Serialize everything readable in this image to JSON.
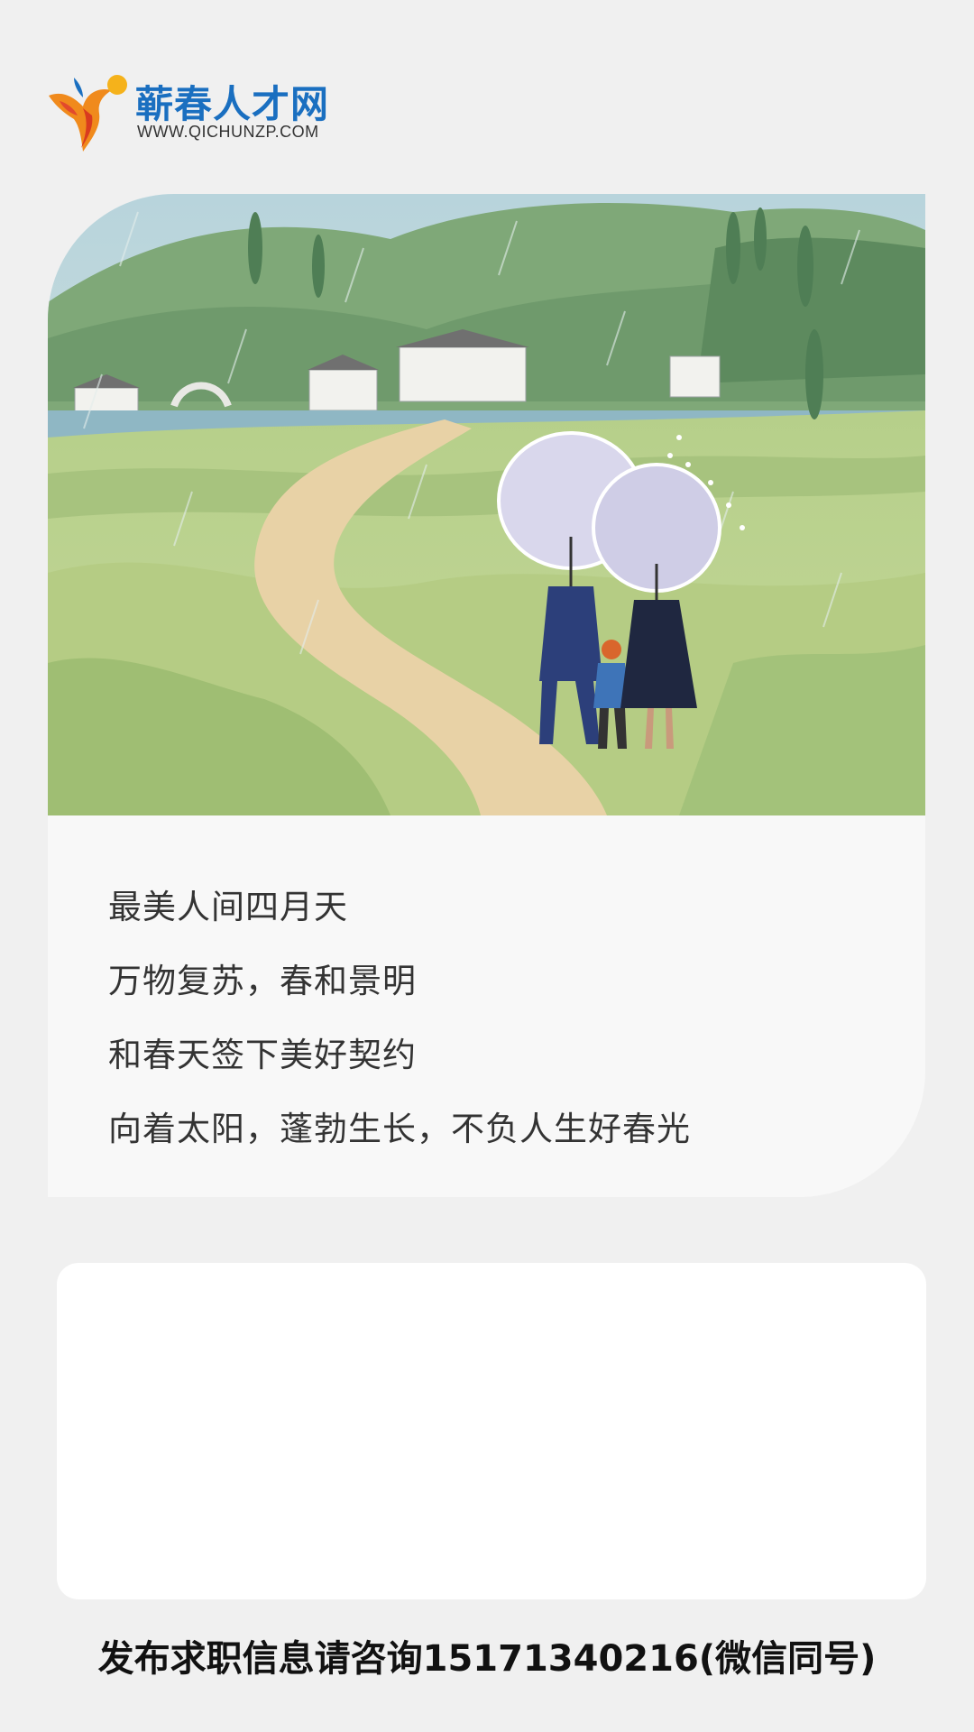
{
  "brand": {
    "name_cn": "蕲春人才网",
    "url": "WWW.QICHUNZP.COM",
    "logo_icon": "running-person-icon",
    "primary_color": "#1a6fc0",
    "accent_color": "#f08a1c"
  },
  "illustration": {
    "icon": "family-walking-in-spring-rain-illustration"
  },
  "poem": {
    "lines": [
      "最美人间四月天",
      "万物复苏，春和景明",
      "和春天签下美好契约",
      "向着太阳，蓬勃生长，不负人生好春光"
    ]
  },
  "footer": {
    "contact": "发布求职信息请咨询15171340216(微信同号)"
  }
}
